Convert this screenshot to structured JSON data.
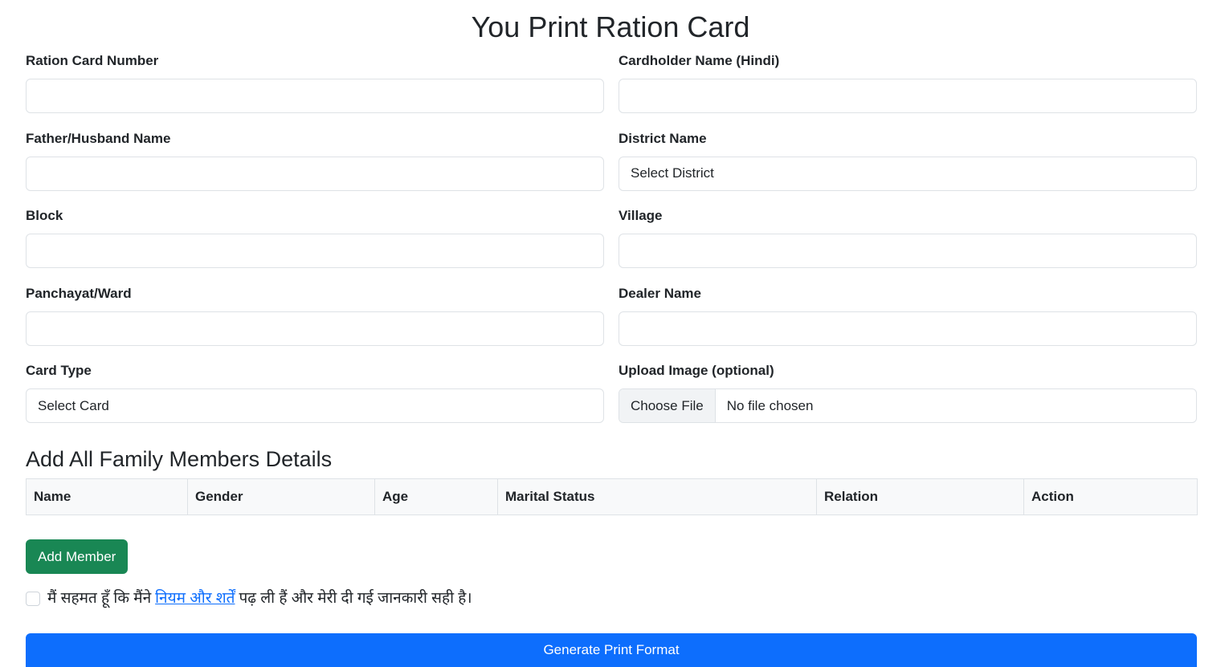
{
  "title": "You Print Ration Card",
  "fields": {
    "ration_card_number": {
      "label": "Ration Card Number",
      "value": ""
    },
    "cardholder_name_hindi": {
      "label": "Cardholder Name (Hindi)",
      "value": ""
    },
    "father_husband_name": {
      "label": "Father/Husband Name",
      "value": ""
    },
    "district_name": {
      "label": "District Name",
      "selected": "Select District"
    },
    "block": {
      "label": "Block",
      "value": ""
    },
    "village": {
      "label": "Village",
      "value": ""
    },
    "panchayat_ward": {
      "label": "Panchayat/Ward",
      "value": ""
    },
    "dealer_name": {
      "label": "Dealer Name",
      "value": ""
    },
    "card_type": {
      "label": "Card Type",
      "selected": "Select Card"
    },
    "upload_image": {
      "label": "Upload Image (optional)",
      "button": "Choose File",
      "status": "No file chosen"
    }
  },
  "family": {
    "heading": "Add All Family Members Details",
    "columns": [
      "Name",
      "Gender",
      "Age",
      "Marital Status",
      "Relation",
      "Action"
    ],
    "add_button": "Add Member"
  },
  "agreement": {
    "text_before": "मैं सहमत हूँ कि मैंने",
    "link": "नियम और शर्तें",
    "text_after": "पढ़ ली हैं और मेरी दी गई जानकारी सही है।",
    "checked": false
  },
  "submit_label": "Generate Print Format",
  "colors": {
    "primary": "#0d6efd",
    "success": "#198754",
    "border": "#dee2e6",
    "table_header_bg": "#f8f9fa"
  }
}
